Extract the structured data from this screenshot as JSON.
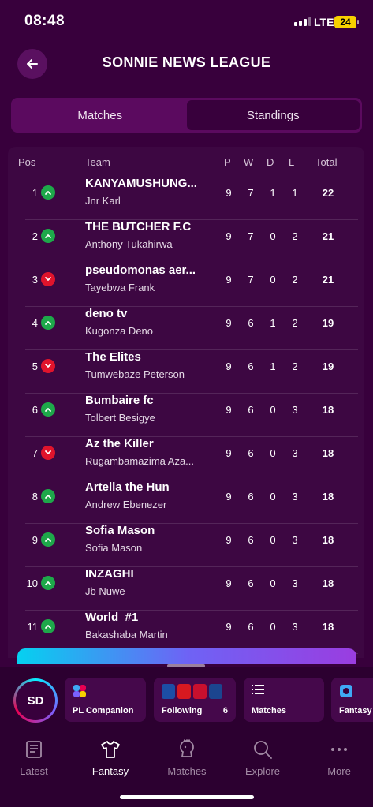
{
  "status_bar": {
    "time": "08:48",
    "network": "LTE",
    "battery": "24"
  },
  "header": {
    "title": "SONNIE NEWS LEAGUE"
  },
  "tabs": [
    {
      "label": "Matches",
      "active": false
    },
    {
      "label": "Standings",
      "active": true
    }
  ],
  "table": {
    "headers": {
      "pos": "Pos",
      "team": "Team",
      "p": "P",
      "w": "W",
      "d": "D",
      "l": "L",
      "total": "Total"
    },
    "rows": [
      {
        "pos": "1",
        "trend": "up",
        "team": "KANYAMUSHUNG...",
        "manager": "Jnr Karl",
        "p": "9",
        "w": "7",
        "d": "1",
        "l": "1",
        "total": "22"
      },
      {
        "pos": "2",
        "trend": "up",
        "team": "THE BUTCHER F.C",
        "manager": "Anthony Tukahirwa",
        "p": "9",
        "w": "7",
        "d": "0",
        "l": "2",
        "total": "21"
      },
      {
        "pos": "3",
        "trend": "down",
        "team": "pseudomonas aer...",
        "manager": "Tayebwa Frank",
        "p": "9",
        "w": "7",
        "d": "0",
        "l": "2",
        "total": "21"
      },
      {
        "pos": "4",
        "trend": "up",
        "team": "deno tv",
        "manager": "Kugonza Deno",
        "p": "9",
        "w": "6",
        "d": "1",
        "l": "2",
        "total": "19"
      },
      {
        "pos": "5",
        "trend": "down",
        "team": "The Elites",
        "manager": "Tumwebaze Peterson",
        "p": "9",
        "w": "6",
        "d": "1",
        "l": "2",
        "total": "19"
      },
      {
        "pos": "6",
        "trend": "up",
        "team": "Bumbaire fc",
        "manager": "Tolbert Besigye",
        "p": "9",
        "w": "6",
        "d": "0",
        "l": "3",
        "total": "18"
      },
      {
        "pos": "7",
        "trend": "down",
        "team": "Az the Killer",
        "manager": "Rugambamazima Aza...",
        "p": "9",
        "w": "6",
        "d": "0",
        "l": "3",
        "total": "18"
      },
      {
        "pos": "8",
        "trend": "up",
        "team": "Artella the Hun",
        "manager": "Andrew Ebenezer",
        "p": "9",
        "w": "6",
        "d": "0",
        "l": "3",
        "total": "18"
      },
      {
        "pos": "9",
        "trend": "up",
        "team": "Sofia Mason",
        "manager": "Sofia Mason",
        "p": "9",
        "w": "6",
        "d": "0",
        "l": "3",
        "total": "18"
      },
      {
        "pos": "10",
        "trend": "up",
        "team": "INZAGHI",
        "manager": "Jb Nuwe",
        "p": "9",
        "w": "6",
        "d": "0",
        "l": "3",
        "total": "18"
      },
      {
        "pos": "11",
        "trend": "up",
        "team": "World_#1",
        "manager": "Bakashaba Martin",
        "p": "9",
        "w": "6",
        "d": "0",
        "l": "3",
        "total": "18"
      }
    ]
  },
  "shortcuts": {
    "avatar_initials": "SD",
    "items": [
      {
        "label": "PL Companion",
        "icon": "pl-companion-icon"
      },
      {
        "label": "Following",
        "count": "6",
        "icon": "club-badges-icon"
      },
      {
        "label": "Matches",
        "icon": "list-icon"
      },
      {
        "label": "Fantasy",
        "icon": "fantasy-icon"
      }
    ]
  },
  "bottom_nav": [
    {
      "label": "Latest",
      "icon": "news-icon",
      "active": false
    },
    {
      "label": "Fantasy",
      "icon": "shirt-icon",
      "active": true
    },
    {
      "label": "Matches",
      "icon": "lion-icon",
      "active": false
    },
    {
      "label": "Explore",
      "icon": "search-icon",
      "active": false
    },
    {
      "label": "More",
      "icon": "more-icon",
      "active": false
    }
  ],
  "colors": {
    "background": "#38003c",
    "trend_up": "#1ea84a",
    "trend_down": "#e0142c",
    "accent_cyan": "#05d1f0"
  }
}
